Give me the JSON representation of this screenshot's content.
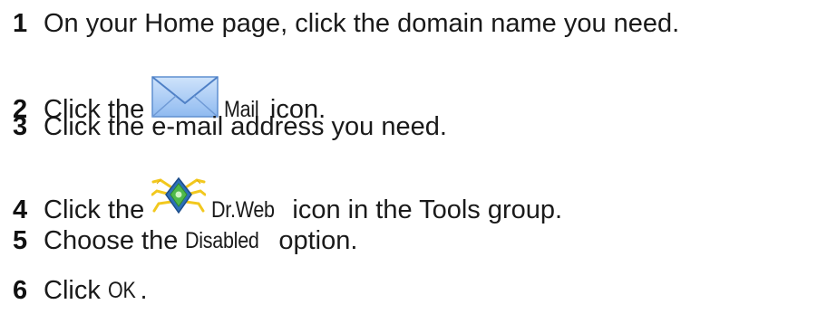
{
  "steps": [
    {
      "number": "1",
      "text": "On your Home page, click the domain name you need."
    },
    {
      "number": "2",
      "before": "Click the",
      "icon": "mail-envelope-icon",
      "label": "Mail",
      "after": "icon."
    },
    {
      "number": "3",
      "text": "Click the e-mail address you need."
    },
    {
      "number": "4",
      "before": "Click the",
      "icon": "drweb-spider-icon",
      "label": "Dr.Web",
      "after": "icon in the Tools group."
    },
    {
      "number": "5",
      "before": "Choose the",
      "label": "Disabled",
      "after": "option."
    },
    {
      "number": "6",
      "before": "Click",
      "label": "OK",
      "after": "."
    }
  ]
}
